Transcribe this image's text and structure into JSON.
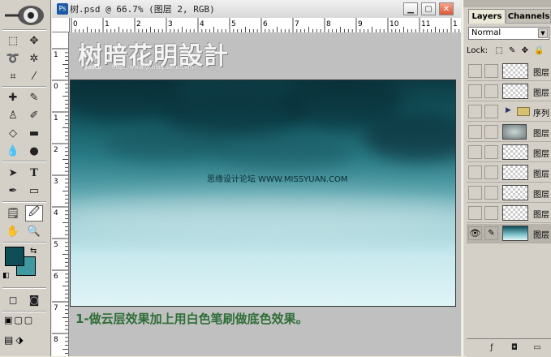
{
  "document": {
    "title": "树.psd @ 66.7% (图层 2, RGB)",
    "h_ruler_ticks": [
      "0",
      "1",
      "2",
      "3",
      "4",
      "5",
      "6",
      "7",
      "8",
      "9",
      "10",
      "11",
      "1"
    ],
    "v_ruler_ticks": [
      "1",
      "0",
      "1",
      "2",
      "3",
      "4",
      "5",
      "6",
      "7",
      "8"
    ]
  },
  "canvas": {
    "logo_title": "树暗花明設計",
    "logo_sub": "yoocb",
    "logo_url": "http://wwwlyf.blog.sohu.com",
    "watermark": "思缘设计论坛 WWW.MISSYUAN.COM"
  },
  "caption": "1-做云层效果加上用白色笔刷做底色效果。",
  "layers_panel": {
    "tabs": [
      "Layers",
      "Channels"
    ],
    "blend_mode": "Normal",
    "lock_label": "Lock:",
    "layers": [
      {
        "name": "图层",
        "visible": false,
        "thumb": "transparent"
      },
      {
        "name": "图层",
        "visible": false,
        "thumb": "transparent"
      },
      {
        "name": "序列",
        "visible": false,
        "thumb": "folder"
      },
      {
        "name": "图层",
        "visible": false,
        "thumb": "gray"
      },
      {
        "name": "图层",
        "visible": false,
        "thumb": "transparent"
      },
      {
        "name": "图层",
        "visible": false,
        "thumb": "transparent"
      },
      {
        "name": "图层",
        "visible": false,
        "thumb": "transparent"
      },
      {
        "name": "图层",
        "visible": false,
        "thumb": "transparent"
      },
      {
        "name": "图层",
        "visible": true,
        "thumb": "teal"
      }
    ]
  },
  "colors": {
    "foreground": "#0f4d57",
    "background": "#3e9aa0",
    "caption": "#2f6e38"
  }
}
